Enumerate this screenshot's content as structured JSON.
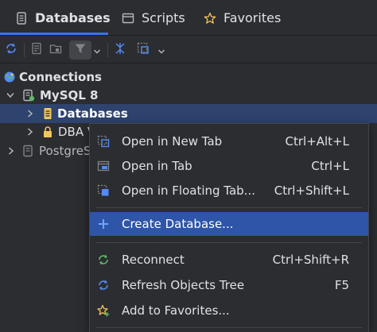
{
  "tabs": [
    {
      "label": "Databases",
      "icon": "database-icon",
      "active": true
    },
    {
      "label": "Scripts",
      "icon": "scripts-icon",
      "active": false
    },
    {
      "label": "Favorites",
      "icon": "star-icon",
      "active": false
    }
  ],
  "toolbar": {
    "buttons": [
      "refresh-icon",
      "properties-icon",
      "new-object-icon",
      "filter-icon",
      "chevron-down-icon",
      "collapse-icon",
      "new-query-icon",
      "chevron-down-icon"
    ]
  },
  "tree": {
    "connections_label": "Connections",
    "mysql_label": "MySQL 8",
    "databases_label": "Databases",
    "dba_label": "DBA V",
    "postgres_label": "PostgreS"
  },
  "menu": {
    "items": [
      {
        "label": "Open in New Tab",
        "shortcut": "Ctrl+Alt+L",
        "icon": "open-new-tab-icon"
      },
      {
        "label": "Open in Tab",
        "shortcut": "Ctrl+L",
        "icon": "open-tab-icon"
      },
      {
        "label": "Open in Floating Tab...",
        "shortcut": "Ctrl+Shift+L",
        "icon": "open-floating-tab-icon"
      },
      {
        "label": "Create Database...",
        "shortcut": "",
        "icon": "plus-icon",
        "highlighted": true
      },
      {
        "label": "Reconnect",
        "shortcut": "Ctrl+Shift+R",
        "icon": "reconnect-icon"
      },
      {
        "label": "Refresh Objects Tree",
        "shortcut": "F5",
        "icon": "refresh-icon"
      },
      {
        "label": "Add to Favorites...",
        "shortcut": "",
        "icon": "add-favorite-icon"
      }
    ]
  },
  "colors": {
    "background": "#2b2d30",
    "accent": "#3574f0",
    "selection": "#2e436e",
    "menu_highlight": "#2e55a8",
    "icon_blue": "#548af7",
    "icon_green": "#5fb865",
    "icon_yellow": "#f2c55c"
  }
}
